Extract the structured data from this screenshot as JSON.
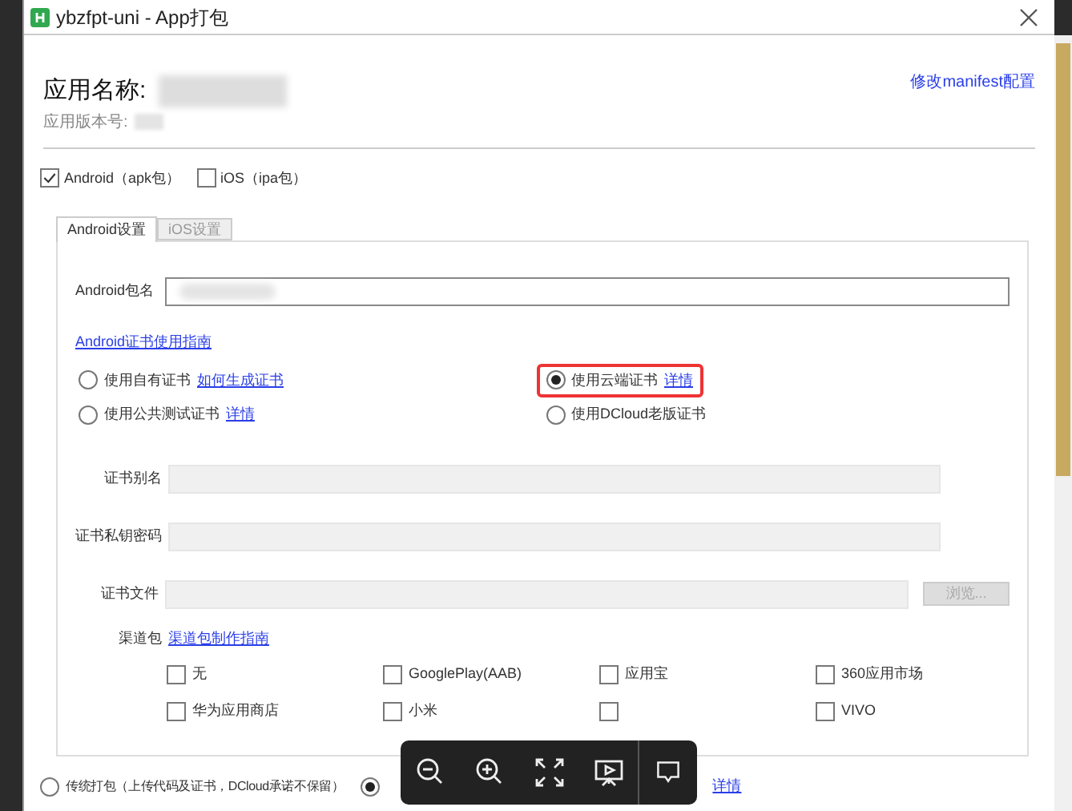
{
  "window": {
    "title": "ybzfpt-uni - App打包"
  },
  "app": {
    "name_label": "应用名称:",
    "version_label": "应用版本号:",
    "manifest_link": "修改manifest配置"
  },
  "platforms": [
    {
      "label": "Android（apk包）",
      "checked": true
    },
    {
      "label": "iOS（ipa包）",
      "checked": false
    }
  ],
  "tabs": [
    {
      "label": "Android设置",
      "selected": true
    },
    {
      "label": "iOS设置",
      "selected": false
    }
  ],
  "package_name": {
    "label": "Android包名"
  },
  "cert_guide_link": "Android证书使用指南",
  "cert_options": [
    {
      "label": "使用自有证书",
      "link": "如何生成证书",
      "selected": false,
      "highlighted": false
    },
    {
      "label": "使用云端证书",
      "link": "详情",
      "selected": true,
      "highlighted": true
    },
    {
      "label": "使用公共测试证书",
      "link": "详情",
      "selected": false,
      "highlighted": false
    },
    {
      "label": "使用DCloud老版证书",
      "selected": false,
      "highlighted": false
    }
  ],
  "cert_fields": [
    {
      "label": "证书别名"
    },
    {
      "label": "证书私钥密码"
    },
    {
      "label": "证书文件",
      "button": "浏览..."
    }
  ],
  "channels": {
    "label": "渠道包",
    "link": "渠道包制作指南",
    "items": [
      {
        "label": "无",
        "checked": false
      },
      {
        "label": "GooglePlay(AAB)",
        "checked": false
      },
      {
        "label": "应用宝",
        "checked": false
      },
      {
        "label": "360应用市场",
        "checked": false
      },
      {
        "label": "华为应用商店",
        "checked": false
      },
      {
        "label": "小米",
        "checked": false
      },
      {
        "checked": false
      },
      {
        "label": "VIVO",
        "checked": false
      }
    ]
  },
  "pack_modes": [
    {
      "label": "传统打包（上传代码及证书，DCloud承诺不保留）",
      "selected": false
    },
    {
      "selected": true,
      "link": "详情"
    }
  ]
}
